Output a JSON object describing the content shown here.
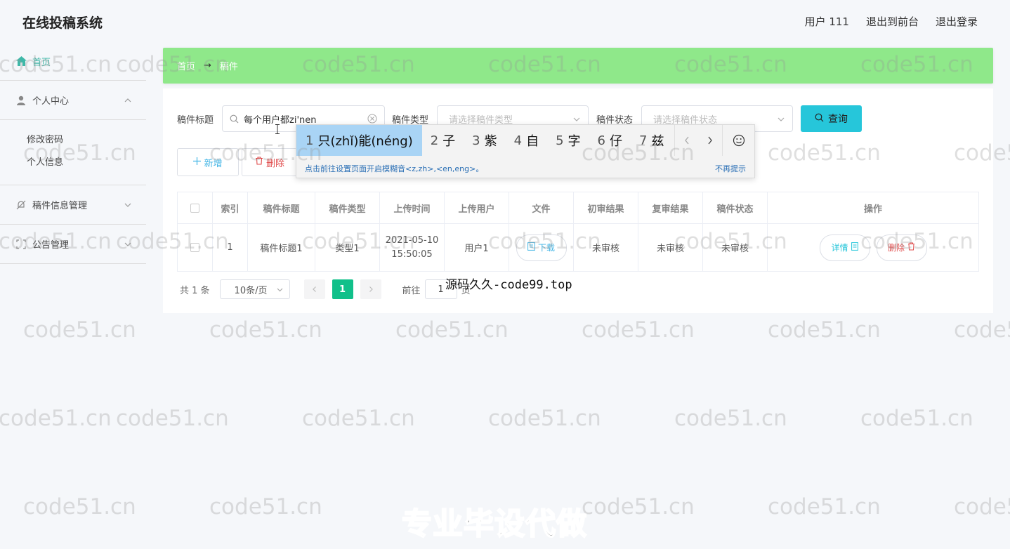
{
  "header": {
    "title": "在线投稿系统",
    "user": "用户 111",
    "front_link": "退出到前台",
    "logout_link": "退出登录"
  },
  "sidebar": {
    "home": "首页",
    "personal_center": "个人中心",
    "change_password": "修改密码",
    "personal_info": "个人信息",
    "manuscript_mgmt": "稿件信息管理",
    "notice_mgmt": "公告管理"
  },
  "breadcrumb": {
    "home": "首页",
    "sep": "→",
    "current": "稿件"
  },
  "filters": {
    "title_label": "稿件标题",
    "title_value": "每个用户都zi'nen",
    "type_label": "稿件类型",
    "type_placeholder": "请选择稿件类型",
    "status_label": "稿件状态",
    "status_placeholder": "请选择稿件状态",
    "query_label": "查询"
  },
  "actions": {
    "add": "新增",
    "delete": "删除"
  },
  "table": {
    "headers": [
      "索引",
      "稿件标题",
      "稿件类型",
      "上传时间",
      "上传用户",
      "文件",
      "初审结果",
      "复审结果",
      "稿件状态",
      "操作"
    ],
    "rows": [
      {
        "index": "1",
        "title": "稿件标题1",
        "type": "类型1",
        "time": "2021-05-10 15:50:05",
        "user": "用户1",
        "file_btn": "下载",
        "first_review": "未审核",
        "second_review": "未审核",
        "status": "未审核",
        "detail_btn": "详情",
        "delete_btn": "删除"
      }
    ]
  },
  "pagination": {
    "total": "共 1 条",
    "page_size": "10条/页",
    "current": "1",
    "goto_label": "前往",
    "goto_value": "1",
    "page_unit": "页"
  },
  "ime": {
    "candidates": [
      {
        "num": "1",
        "text": "只(zhǐ)能(néng)"
      },
      {
        "num": "2",
        "text": "子"
      },
      {
        "num": "3",
        "text": "紫"
      },
      {
        "num": "4",
        "text": "自"
      },
      {
        "num": "5",
        "text": "字"
      },
      {
        "num": "6",
        "text": "仔"
      },
      {
        "num": "7",
        "text": "兹"
      }
    ],
    "tip": "点击前往设置页面开启模糊音<z,zh>,<en,eng>。",
    "dismiss": "不再提示"
  },
  "overlays": {
    "watermark": "code51.cn",
    "source": "源码久久-code99.top",
    "promo": "专业毕设代做"
  },
  "colors": {
    "breadcrumb_bg": "#8fe88a",
    "query_btn": "#26c6da",
    "pager_active": "#11c08a",
    "home_active": "#3fb8a8"
  }
}
